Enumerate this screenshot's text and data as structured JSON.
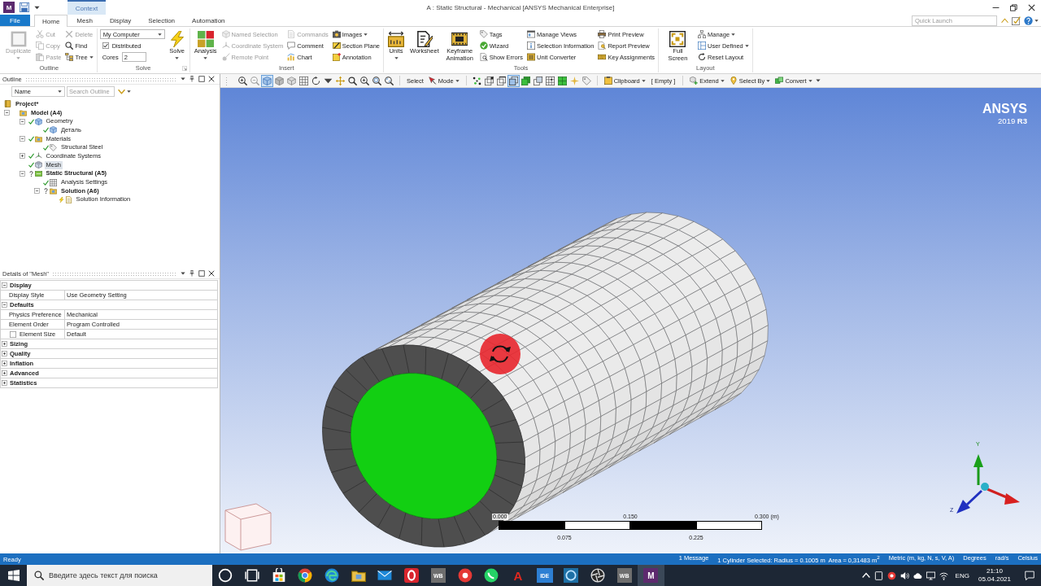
{
  "title_bar": {
    "app_icon": "M",
    "context_tab": "Context",
    "title": "A : Static Structural - Mechanical [ANSYS Mechanical Enterprise]"
  },
  "tabs": [
    {
      "label": "File",
      "kind": "file",
      "selected": false
    },
    {
      "label": "Home",
      "kind": "tab",
      "selected": true
    },
    {
      "label": "Mesh",
      "kind": "tab",
      "selected": false
    },
    {
      "label": "Display",
      "kind": "tab",
      "selected": false
    },
    {
      "label": "Selection",
      "kind": "tab",
      "selected": false
    },
    {
      "label": "Automation",
      "kind": "tab",
      "selected": false
    }
  ],
  "quick_launch": {
    "placeholder": "Quick Launch"
  },
  "ribbon": [
    {
      "label": "Outline",
      "launcher": false,
      "columns": [
        [
          {
            "kind": "large",
            "label": "Duplicate",
            "disabled": true,
            "dropdown": true
          }
        ],
        [
          {
            "kind": "small",
            "label": "Cut",
            "disabled": true,
            "dropdown": false
          },
          {
            "kind": "small",
            "label": "Copy",
            "disabled": true,
            "dropdown": false
          },
          {
            "kind": "small",
            "label": "Paste",
            "disabled": true,
            "dropdown": false
          }
        ],
        [
          {
            "kind": "small",
            "label": "Delete",
            "disabled": true,
            "dropdown": false
          },
          {
            "kind": "small",
            "label": "Find",
            "disabled": false,
            "dropdown": false
          },
          {
            "kind": "small",
            "label": "Tree",
            "disabled": false,
            "dropdown": true
          }
        ]
      ]
    },
    {
      "label": "Solve",
      "launcher": true,
      "columns": [
        [
          {
            "kind": "select",
            "value": "My Computer"
          },
          {
            "kind": "checkbox",
            "label": "Distributed",
            "checked": true
          },
          {
            "kind": "field",
            "label": "Cores",
            "value": "2"
          }
        ],
        [
          {
            "kind": "large",
            "label": "Solve",
            "disabled": false,
            "dropdown": true
          }
        ]
      ]
    },
    {
      "label": "Insert",
      "launcher": false,
      "columns": [
        [
          {
            "kind": "large",
            "label": "Analysis",
            "disabled": false,
            "dropdown": true
          }
        ],
        [
          {
            "kind": "small",
            "label": "Named Selection",
            "disabled": true,
            "dropdown": false
          },
          {
            "kind": "small",
            "label": "Coordinate System",
            "disabled": true,
            "dropdown": false
          },
          {
            "kind": "small",
            "label": "Remote Point",
            "disabled": true,
            "dropdown": false
          }
        ],
        [
          {
            "kind": "small",
            "label": "Commands",
            "disabled": true,
            "dropdown": false
          },
          {
            "kind": "small",
            "label": "Comment",
            "disabled": false,
            "dropdown": false
          },
          {
            "kind": "small",
            "label": "Chart",
            "disabled": false,
            "dropdown": false
          }
        ],
        [
          {
            "kind": "small",
            "label": "Images",
            "disabled": false,
            "dropdown": true
          },
          {
            "kind": "small",
            "label": "Section Plane",
            "disabled": false,
            "dropdown": false
          },
          {
            "kind": "small",
            "label": "Annotation",
            "disabled": false,
            "dropdown": false
          }
        ]
      ]
    },
    {
      "label": "Tools",
      "launcher": false,
      "columns": [
        [
          {
            "kind": "large",
            "label": "Units",
            "disabled": false,
            "dropdown": true
          }
        ],
        [
          {
            "kind": "large",
            "label": "Worksheet",
            "disabled": false,
            "dropdown": false
          }
        ],
        [
          {
            "kind": "large",
            "label": "Keyframe Animation",
            "disabled": false,
            "dropdown": false
          }
        ],
        [
          {
            "kind": "small",
            "label": "Tags",
            "disabled": false,
            "dropdown": false
          },
          {
            "kind": "small",
            "label": "Wizard",
            "disabled": false,
            "dropdown": false
          },
          {
            "kind": "small",
            "label": "Show Errors",
            "disabled": false,
            "dropdown": false
          }
        ],
        [
          {
            "kind": "small",
            "label": "Manage Views",
            "disabled": false,
            "dropdown": false
          },
          {
            "kind": "small",
            "label": "Selection Information",
            "disabled": false,
            "dropdown": false
          },
          {
            "kind": "small",
            "label": "Unit Converter",
            "disabled": false,
            "dropdown": false
          }
        ],
        [
          {
            "kind": "small",
            "label": "Print Preview",
            "disabled": false,
            "dropdown": false
          },
          {
            "kind": "small",
            "label": "Report Preview",
            "disabled": false,
            "dropdown": false
          },
          {
            "kind": "small",
            "label": "Key Assignments",
            "disabled": false,
            "dropdown": false
          }
        ]
      ]
    },
    {
      "label": "Layout",
      "launcher": false,
      "columns": [
        [
          {
            "kind": "large",
            "label": "Full Screen",
            "disabled": false,
            "dropdown": false
          }
        ],
        [
          {
            "kind": "small",
            "label": "Manage",
            "disabled": false,
            "dropdown": true
          },
          {
            "kind": "small",
            "label": "User Defined",
            "disabled": false,
            "dropdown": true
          },
          {
            "kind": "small",
            "label": "Reset Layout",
            "disabled": false,
            "dropdown": false
          }
        ]
      ]
    }
  ],
  "outline": {
    "title": "Outline",
    "filter": {
      "value": "Name"
    },
    "search": {
      "placeholder": "Search Outline"
    },
    "tree": [
      {
        "label": "Project*",
        "kind": "project",
        "emphasized": true,
        "selected": false,
        "complete": false,
        "underdefined": false,
        "needs_solve": false,
        "children": [
          {
            "label": "Model (A4)",
            "kind": "model",
            "emphasized": true,
            "selected": false,
            "expanded": true,
            "complete": false,
            "underdefined": false,
            "needs_solve": false,
            "children": [
              {
                "label": "Geometry",
                "kind": "geometry",
                "emphasized": false,
                "selected": false,
                "expanded": true,
                "complete": true,
                "underdefined": false,
                "needs_solve": false,
                "children": [
                  {
                    "label": "Деталь",
                    "kind": "part",
                    "emphasized": false,
                    "selected": false,
                    "complete": true,
                    "underdefined": false,
                    "needs_solve": false
                  }
                ]
              },
              {
                "label": "Materials",
                "kind": "materials",
                "emphasized": false,
                "selected": false,
                "expanded": true,
                "complete": true,
                "underdefined": false,
                "needs_solve": false,
                "children": [
                  {
                    "label": "Structural Steel",
                    "kind": "material",
                    "emphasized": false,
                    "selected": false,
                    "complete": true,
                    "underdefined": false,
                    "needs_solve": false
                  }
                ]
              },
              {
                "label": "Coordinate Systems",
                "kind": "coordinates",
                "emphasized": false,
                "selected": false,
                "expanded": false,
                "complete": true,
                "underdefined": false,
                "needs_solve": false
              },
              {
                "label": "Mesh",
                "kind": "mesh",
                "emphasized": false,
                "selected": true,
                "complete": true,
                "underdefined": false,
                "needs_solve": false
              },
              {
                "label": "Static Structural (A5)",
                "kind": "analysis",
                "emphasized": true,
                "selected": false,
                "expanded": true,
                "complete": false,
                "underdefined": true,
                "needs_solve": false,
                "children": [
                  {
                    "label": "Analysis Settings",
                    "kind": "settings",
                    "emphasized": false,
                    "selected": false,
                    "complete": true,
                    "underdefined": false,
                    "needs_solve": false
                  },
                  {
                    "label": "Solution (A6)",
                    "kind": "solution",
                    "emphasized": true,
                    "selected": false,
                    "expanded": true,
                    "complete": false,
                    "underdefined": true,
                    "needs_solve": false,
                    "children": [
                      {
                        "label": "Solution Information",
                        "kind": "information",
                        "emphasized": false,
                        "selected": false,
                        "complete": false,
                        "underdefined": false,
                        "needs_solve": true
                      }
                    ]
                  }
                ]
              }
            ]
          }
        ]
      }
    ]
  },
  "details": {
    "title": "Details of \"Mesh\"",
    "sections": [
      {
        "label": "Display",
        "expanded": true,
        "rows": [
          {
            "kind": "plain",
            "label": "Display Style",
            "value": "Use Geometry Setting"
          }
        ]
      },
      {
        "label": "Defaults",
        "expanded": true,
        "rows": [
          {
            "kind": "plain",
            "label": "Physics Preference",
            "value": "Mechanical"
          },
          {
            "kind": "plain",
            "label": "Element Order",
            "value": "Program Controlled"
          },
          {
            "kind": "parameter",
            "label": "Element Size",
            "value": "Default",
            "checked": false
          }
        ]
      },
      {
        "label": "Sizing",
        "expanded": false
      },
      {
        "label": "Quality",
        "expanded": false
      },
      {
        "label": "Inflation",
        "expanded": false
      },
      {
        "label": "Advanced",
        "expanded": false
      },
      {
        "label": "Statistics",
        "expanded": false
      }
    ]
  },
  "viewport_toolbar": {
    "view_buttons": [
      {
        "selected": false
      },
      {
        "selected": false
      },
      {
        "selected": true
      },
      {
        "selected": false
      },
      {
        "selected": false
      },
      {
        "selected": false
      },
      {
        "selected": false
      },
      {
        "selected": false
      },
      {
        "selected": false
      },
      {
        "selected": false
      },
      {
        "selected": false
      },
      {
        "selected": false
      },
      {
        "selected": false
      }
    ],
    "select_button": "Select",
    "mode_button": "Mode",
    "filter_buttons": [
      {
        "selected": false
      },
      {
        "selected": false
      },
      {
        "selected": false
      },
      {
        "selected": true
      },
      {
        "selected": false
      },
      {
        "selected": false
      },
      {
        "selected": false
      },
      {
        "selected": false
      },
      {
        "selected": false
      },
      {
        "selected": false
      }
    ],
    "clipboard_button": "Clipboard",
    "clipboard_status": "[ Empty ]",
    "extend_button": "Extend",
    "select_by_button": "Select By",
    "convert_button": "Convert"
  },
  "viewport": {
    "logo": "ANSYS",
    "version": "2019 **R3**",
    "scale_bar": {
      "top_labels": [
        "0.000",
        "0.150",
        "0.300 (m)"
      ],
      "bottom_labels": [
        "0.075",
        "0.225"
      ]
    },
    "triad": {
      "y_label": "Y",
      "z_label": "Z"
    }
  },
  "status_bar": {
    "state": "Ready",
    "messages": "1 Message",
    "selection": "1 Cylinder Selected: Radius = 0.1005 m  Area = 0,31483 m$^{2}$",
    "units": "Metric (m, kg, N, s, V, A)",
    "angle": "Degrees",
    "rotational_velocity": "rad/s",
    "temperature": "Celsius"
  },
  "taskbar": {
    "search": {
      "placeholder": "Введите здесь текст для поиска"
    },
    "apps": [
      {
        "selected": false
      },
      {
        "selected": false
      },
      {
        "selected": false
      },
      {
        "selected": false
      },
      {
        "selected": false
      },
      {
        "selected": false
      },
      {
        "selected": false
      },
      {
        "selected": false
      },
      {
        "label": "WB",
        "selected": false
      },
      {
        "selected": false
      },
      {
        "selected": false
      },
      {
        "label": "A",
        "selected": false
      },
      {
        "label": "IDE",
        "selected": false
      },
      {
        "selected": false
      },
      {
        "selected": false
      },
      {
        "label": "WB",
        "selected": false
      },
      {
        "label": "M",
        "selected": true
      }
    ],
    "language": "ENG",
    "time": "21:10",
    "date": "05.04.2021"
  }
}
